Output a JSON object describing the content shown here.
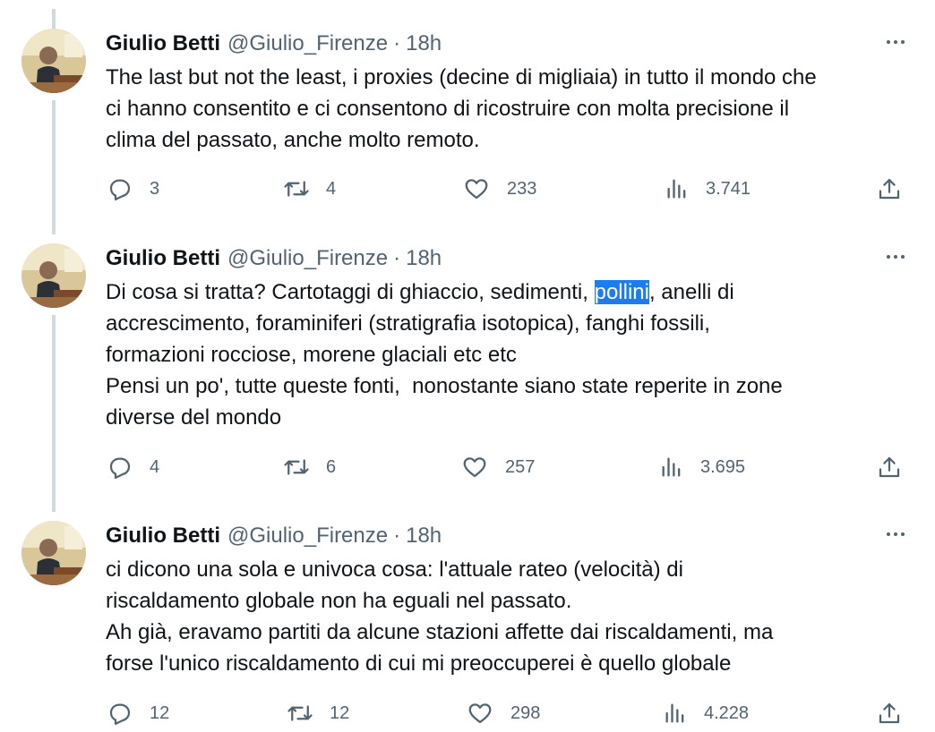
{
  "tweets": [
    {
      "author": "Giulio Betti",
      "handle": "@Giulio_Firenze",
      "separator": "·",
      "time": "18h",
      "text_parts": [
        "The last but not the least, i proxies (decine di migliaia) in tutto il mondo che\nci hanno consentito e ci consentono di ricostruire con molta precisione il\nclima del passato, anche molto remoto."
      ],
      "replies": "3",
      "retweets": "4",
      "likes": "233",
      "views": "3.741"
    },
    {
      "author": "Giulio Betti",
      "handle": "@Giulio_Firenze",
      "separator": "·",
      "time": "18h",
      "text_before": "Di cosa si tratta? Cartotaggi di ghiaccio, sedimenti, ",
      "text_highlight": "pollini",
      "text_after": ", anelli di\naccrescimento, foraminiferi (stratigrafia isotopica), fanghi fossili,\nformazioni rocciose, morene glaciali etc etc\nPensi un po', tutte queste fonti,  nonostante siano state reperite in zone\ndiverse del mondo",
      "replies": "4",
      "retweets": "6",
      "likes": "257",
      "views": "3.695"
    },
    {
      "author": "Giulio Betti",
      "handle": "@Giulio_Firenze",
      "separator": "·",
      "time": "18h",
      "text_parts": [
        "ci dicono una sola e univoca cosa: l'attuale rateo (velocità) di\nriscaldamento globale non ha eguali nel passato.\nAh già, eravamo partiti da alcune stazioni affette dai riscaldamenti, ma\nforse l'unico riscaldamento di cui mi preoccuperei è quello globale"
      ],
      "replies": "12",
      "retweets": "12",
      "likes": "298",
      "views": "4.228"
    }
  ],
  "colors": {
    "text": "#0f1419",
    "secondary": "#536471",
    "thread_line": "#cfd9de",
    "highlight": "#1d7cf2"
  }
}
